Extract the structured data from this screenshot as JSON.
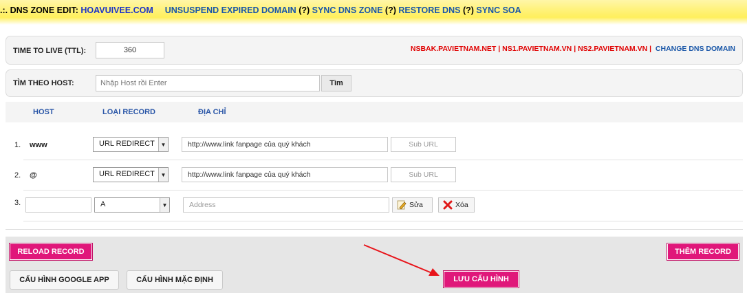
{
  "header": {
    "prefix": ".:. DNS ZONE EDIT:",
    "domain": "HOAVUIVEE.COM",
    "links": [
      {
        "label": "UNSUSPEND EXPIRED DOMAIN",
        "help": "(?)"
      },
      {
        "label": "SYNC DNS ZONE",
        "help": "(?)"
      },
      {
        "label": "RESTORE DNS",
        "help": "(?)"
      },
      {
        "label": "SYNC SOA"
      }
    ]
  },
  "ttl": {
    "label": "TIME TO LIVE (TTL):",
    "value": "360",
    "nameservers": [
      "NSBAK.PAVIETNAM.NET",
      "NS1.PAVIETNAM.VN",
      "NS2.PAVIETNAM.VN"
    ],
    "separator": "|",
    "change_label": "CHANGE DNS DOMAIN"
  },
  "search": {
    "label": "TÌM THEO HOST:",
    "placeholder": "Nhập Host rồi Enter",
    "button": "Tìm"
  },
  "columns": {
    "host": "HOST",
    "record_type": "LOẠI RECORD",
    "address": "ĐỊA CHỈ"
  },
  "rows": [
    {
      "num": "1.",
      "host": "www",
      "type": "URL REDIRECT",
      "address": "http://www.link fanpage của quý khách",
      "sub": "Sub URL"
    },
    {
      "num": "2.",
      "host": "@",
      "type": "URL REDIRECT",
      "address": "http://www.link fanpage của quý khách",
      "sub": "Sub URL"
    },
    {
      "num": "3.",
      "host": "",
      "type": "A",
      "address_placeholder": "Address",
      "edit": "Sửa",
      "delete": "Xóa"
    }
  ],
  "footer": {
    "reload": "RELOAD RECORD",
    "add": "THÊM RECORD",
    "google": "CẤU HÌNH GOOGLE APP",
    "default": "CẤU HÌNH MẶC ĐỊNH",
    "save": "LƯU CẤU HÌNH"
  },
  "colors": {
    "accent_pink": "#e0177a",
    "link_blue": "#1a57a8",
    "ns_red": "#e00000",
    "header_yellow": "#fff27a",
    "annotation_arrow": "#e8141a"
  }
}
